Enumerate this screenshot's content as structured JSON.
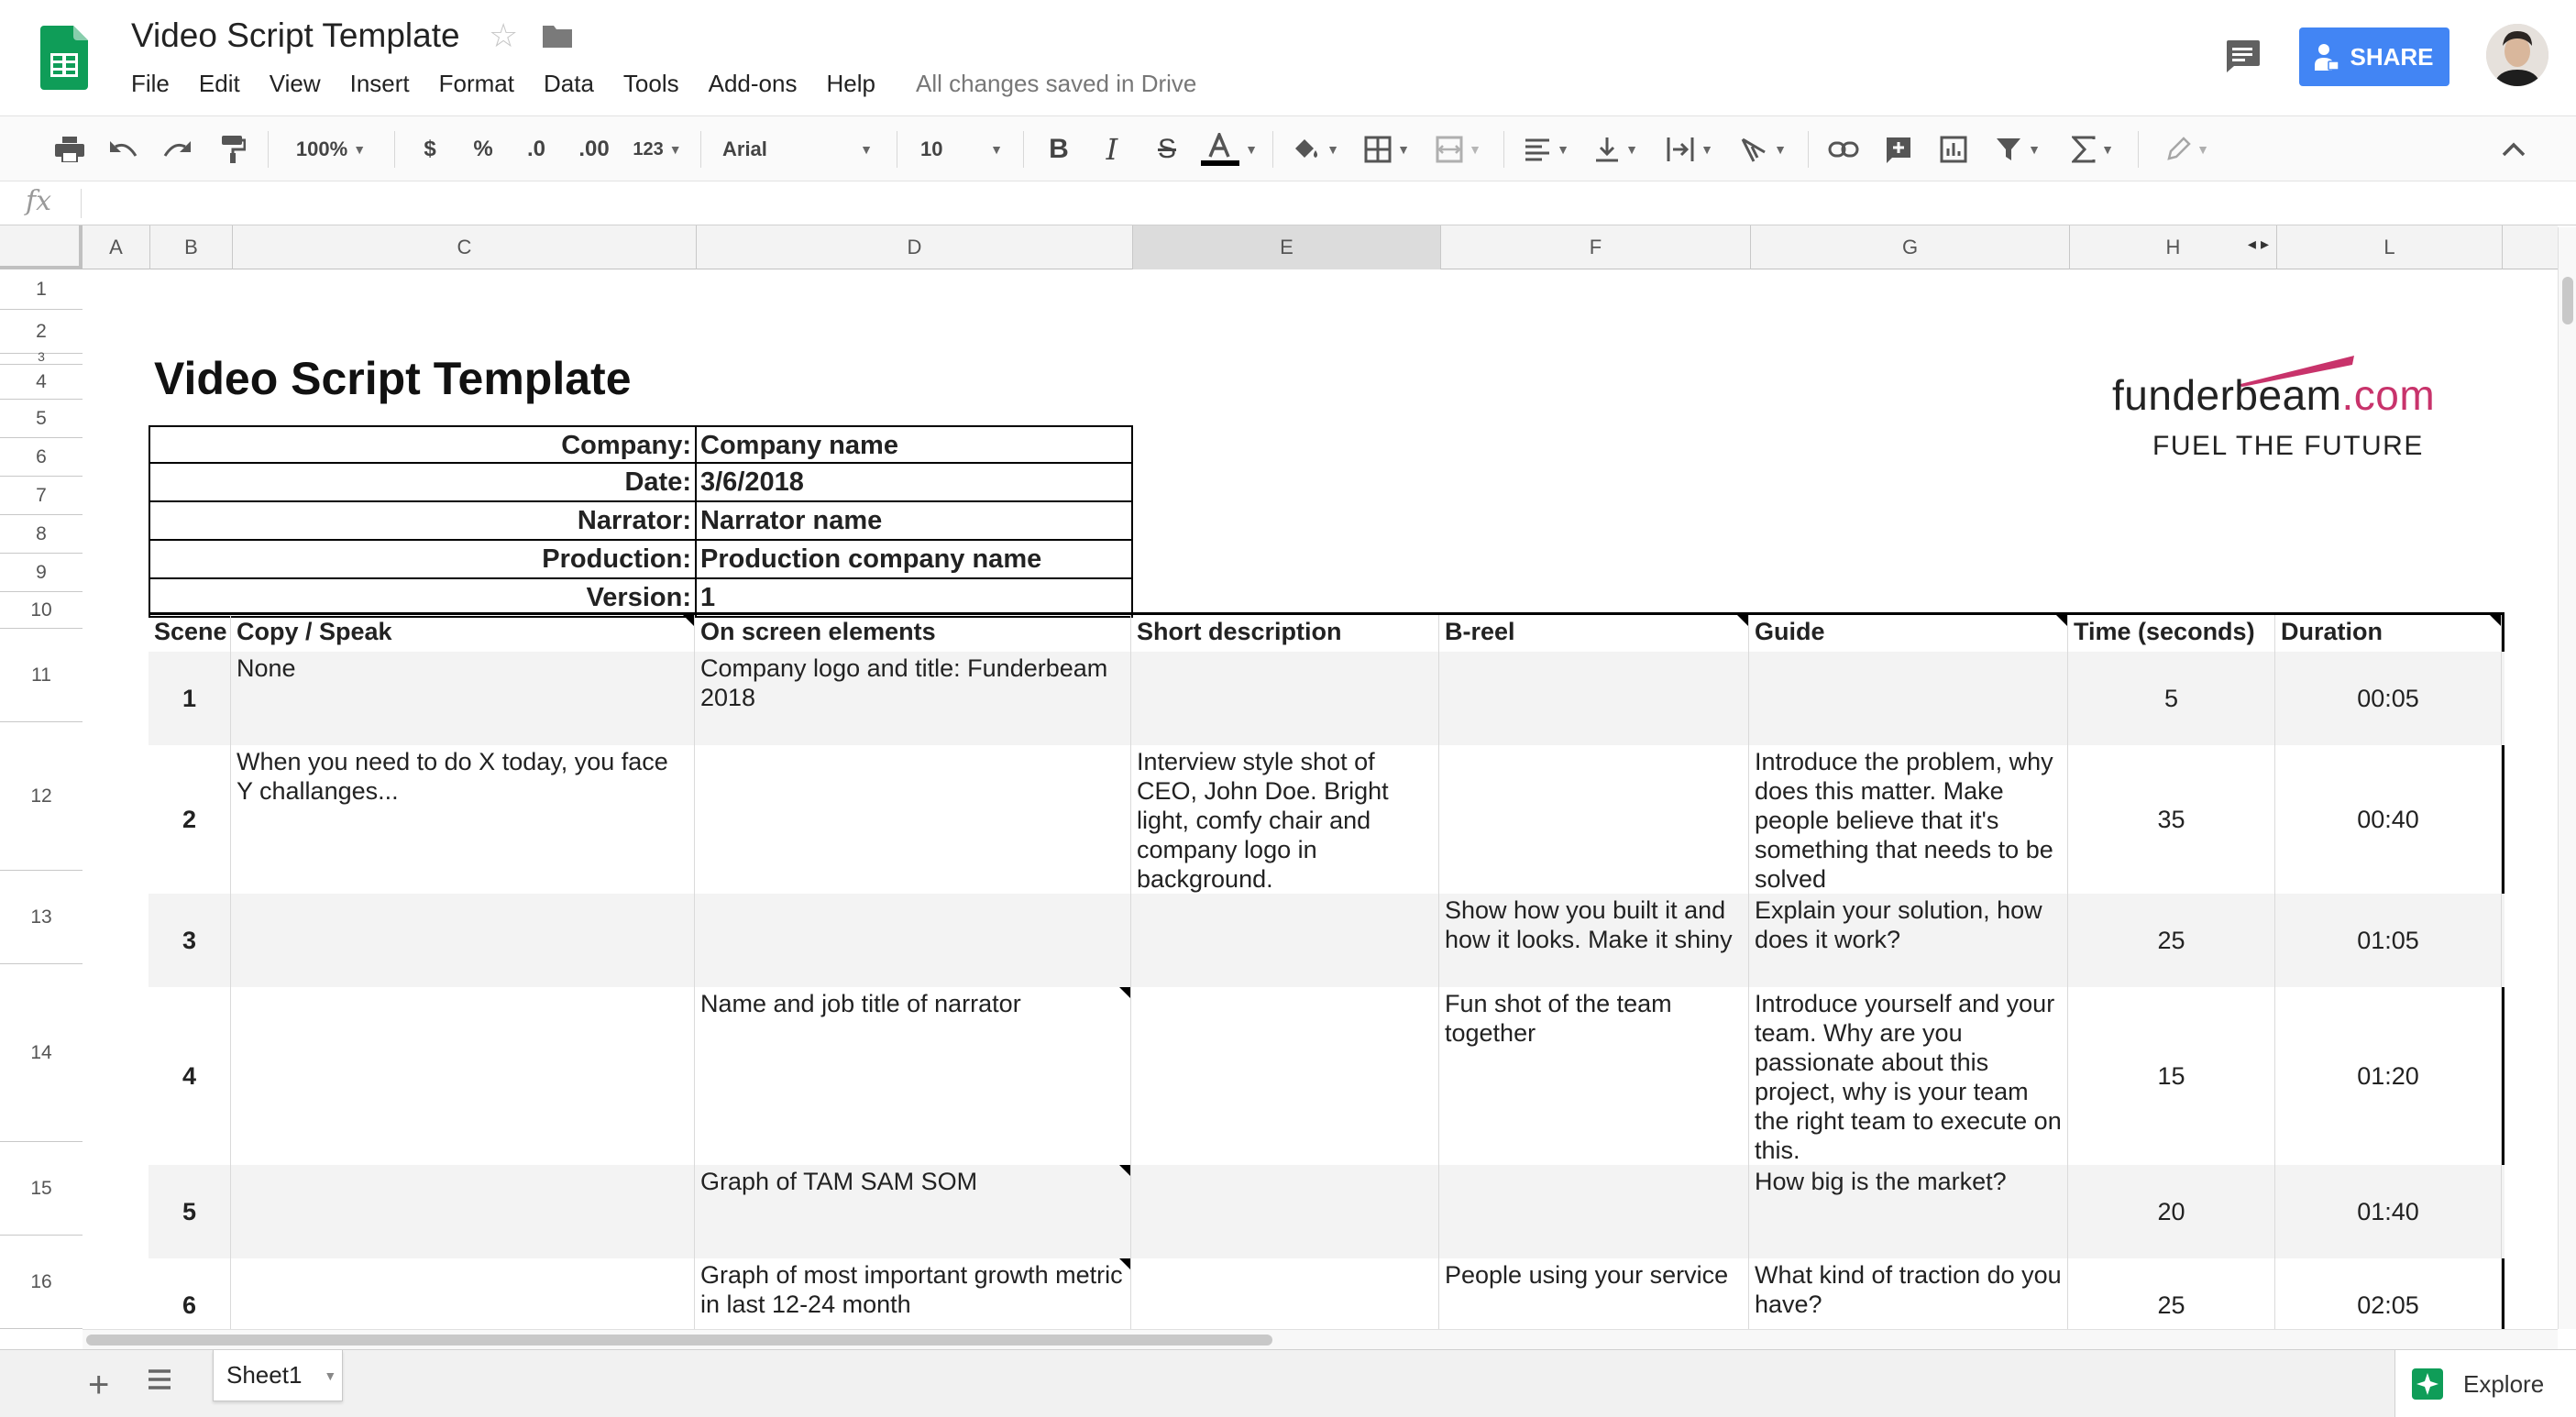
{
  "app": {
    "doc_title": "Video Script Template",
    "menu": [
      "File",
      "Edit",
      "View",
      "Insert",
      "Format",
      "Data",
      "Tools",
      "Add-ons",
      "Help"
    ],
    "save_status": "All changes saved in Drive",
    "share_label": "SHARE",
    "colors": {
      "accent": "#4285f4",
      "sheets_green": "#0f9d58",
      "brand_pink": "#c8336b"
    }
  },
  "toolbar": {
    "zoom": "100%",
    "currency": "$",
    "percent": "%",
    "dec_decrease": ".0",
    "dec_increase": ".00",
    "more_formats": "123",
    "font": "Arial",
    "font_size": "10"
  },
  "grid": {
    "columns": [
      "A",
      "B",
      "C",
      "D",
      "E",
      "F",
      "G",
      "H",
      "L"
    ],
    "rows": [
      "1",
      "2",
      "3",
      "4",
      "5",
      "6",
      "7",
      "8",
      "9",
      "10",
      "11",
      "12",
      "13",
      "14",
      "15",
      "16"
    ]
  },
  "sheet": {
    "title": "Video Script Template",
    "brand_name": "funderbeam",
    "brand_tld": ".com",
    "brand_tagline": "FUEL THE FUTURE",
    "info": [
      {
        "label": "Company:",
        "value": "Company name"
      },
      {
        "label": "Date:",
        "value": "3/6/2018"
      },
      {
        "label": "Narrator:",
        "value": "Narrator name"
      },
      {
        "label": "Production:",
        "value": "Production company name"
      },
      {
        "label": "Version:",
        "value": "1"
      }
    ],
    "headers": [
      "Scene",
      "Copy / Speak",
      "On screen elements",
      "Short description",
      "B-reel",
      "Guide",
      "Time (seconds)",
      "Duration"
    ],
    "scenes": [
      {
        "scene": "1",
        "copy": "None",
        "onscreen": "Company logo and title: Funderbeam 2018",
        "short": "",
        "breel": "",
        "guide": "",
        "time": "5",
        "duration": "00:05"
      },
      {
        "scene": "2",
        "copy": "When you need to do X today, you face Y challanges...",
        "onscreen": "",
        "short": "Interview style shot of CEO, John Doe. Bright light, comfy chair and company logo in background.",
        "breel": "",
        "guide": "Introduce the problem, why does this matter. Make people believe that it's something that needs to be solved",
        "time": "35",
        "duration": "00:40"
      },
      {
        "scene": "3",
        "copy": "",
        "onscreen": "",
        "short": "",
        "breel": "Show how you built it and how it looks. Make it shiny",
        "guide": "Explain your solution, how does it work?",
        "time": "25",
        "duration": "01:05"
      },
      {
        "scene": "4",
        "copy": "",
        "onscreen": "Name and job title of narrator",
        "short": "",
        "breel": "Fun shot of the team together",
        "guide": "Introduce yourself and your team. Why are you passionate about this project, why is your team the right team to execute on this.",
        "time": "15",
        "duration": "01:20"
      },
      {
        "scene": "5",
        "copy": "",
        "onscreen": "Graph of TAM SAM SOM",
        "short": "",
        "breel": "",
        "guide": "How big is the market?",
        "time": "20",
        "duration": "01:40"
      },
      {
        "scene": "6",
        "copy": "",
        "onscreen": "Graph of most important growth metric in last 12-24 month",
        "short": "",
        "breel": "People using your service",
        "guide": "What kind of traction do you have?",
        "time": "25",
        "duration": "02:05"
      }
    ]
  },
  "bottom": {
    "sheet_tab": "Sheet1",
    "explore_label": "Explore"
  }
}
